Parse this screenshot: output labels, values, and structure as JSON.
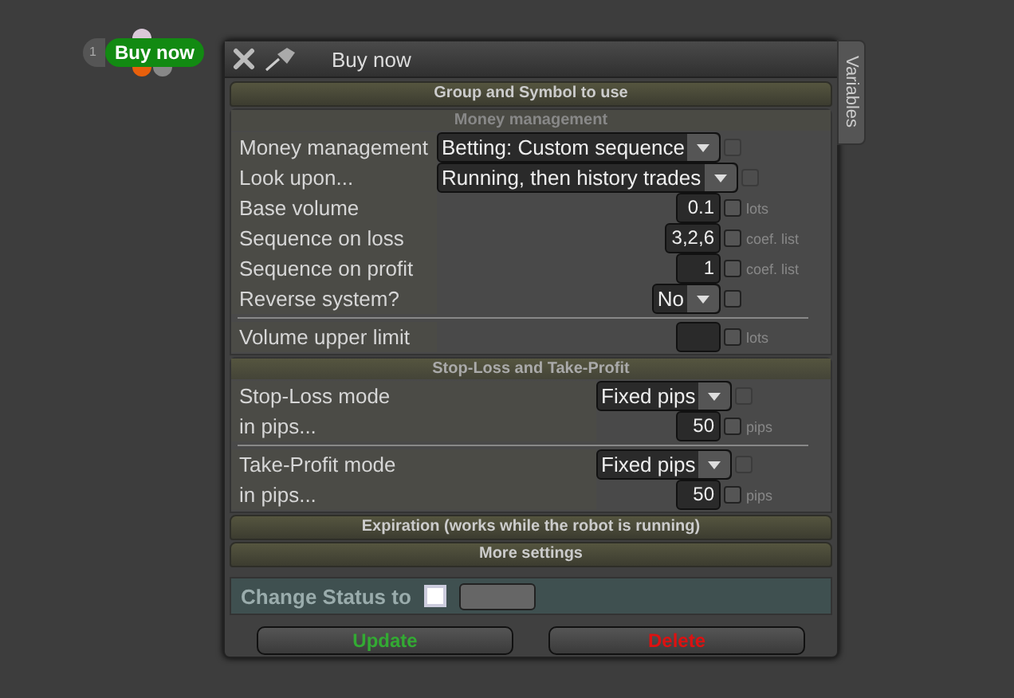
{
  "node": {
    "index": "1",
    "label": "Buy now"
  },
  "window": {
    "title": "Buy now"
  },
  "side_tab": {
    "label": "Variables"
  },
  "sections": [
    {
      "kind": "bar",
      "title": "Group and Symbol to use"
    },
    {
      "kind": "subpanel",
      "title": "Money management",
      "groups": [
        [
          {
            "kind": "select",
            "label": "Money management",
            "value": "Betting: Custom sequence",
            "checkbox": {
              "checked": false,
              "disabled": true
            }
          },
          {
            "kind": "select",
            "label": "Look upon...",
            "value": "Running, then history trades",
            "checkbox": {
              "checked": false,
              "disabled": true
            }
          },
          {
            "kind": "input",
            "label": "Base volume",
            "value": "0.1",
            "unit": "lots",
            "checkbox": {
              "checked": false,
              "disabled": false
            }
          },
          {
            "kind": "input",
            "label": "Sequence on loss",
            "value": "3,2,6",
            "unit": "coef. list",
            "checkbox": {
              "checked": false,
              "disabled": false
            }
          },
          {
            "kind": "input",
            "label": "Sequence on profit",
            "value": "1",
            "unit": "coef. list",
            "checkbox": {
              "checked": false,
              "disabled": false
            }
          },
          {
            "kind": "select",
            "label": "Reverse system?",
            "value": "No",
            "checkbox": {
              "checked": false,
              "disabled": false
            }
          }
        ],
        [
          {
            "kind": "input",
            "label": "Volume upper limit",
            "unit": "lots",
            "checkbox": {
              "checked": false,
              "disabled": false
            }
          }
        ]
      ]
    },
    {
      "kind": "panel",
      "title": "Stop-Loss and Take-Profit",
      "groups": [
        [
          {
            "kind": "select",
            "label": "Stop-Loss mode",
            "value": "Fixed pips",
            "checkbox": {
              "checked": false,
              "disabled": true
            }
          },
          {
            "kind": "input",
            "label": "in pips...",
            "value": "50",
            "unit": "pips",
            "checkbox": {
              "checked": false,
              "disabled": false
            }
          }
        ],
        [
          {
            "kind": "select",
            "label": "Take-Profit mode",
            "value": "Fixed pips",
            "checkbox": {
              "checked": false,
              "disabled": true
            }
          },
          {
            "kind": "input",
            "label": "in pips...",
            "value": "50",
            "unit": "pips",
            "checkbox": {
              "checked": false,
              "disabled": false
            }
          }
        ]
      ]
    },
    {
      "kind": "bar",
      "title": "Expiration (works while the robot is running)"
    },
    {
      "kind": "bar",
      "title": "More settings"
    }
  ],
  "status": {
    "label": "Change Status to",
    "checked": false
  },
  "buttons": [
    {
      "label": "Update",
      "kind": "confirm"
    },
    {
      "label": "Delete",
      "kind": "danger"
    }
  ]
}
